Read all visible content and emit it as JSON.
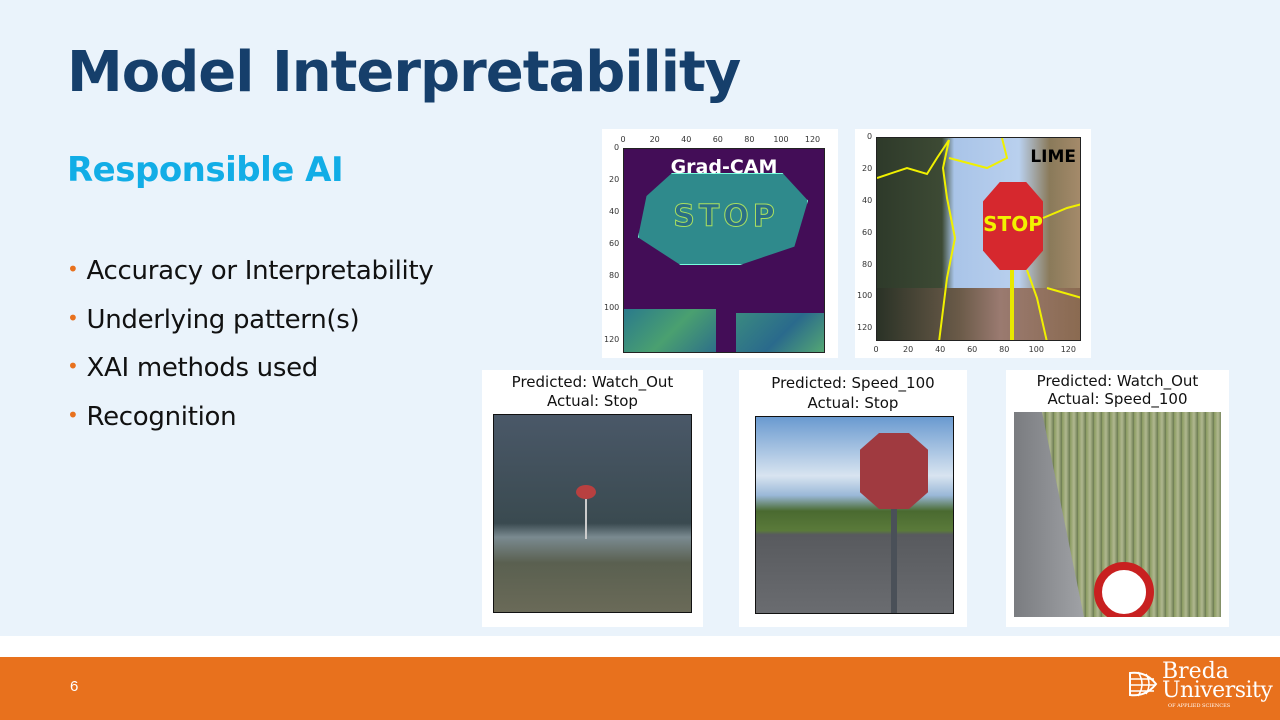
{
  "slide": {
    "title": "Model Interpretability",
    "subtitle": "Responsible AI",
    "bullets": [
      "Accuracy or Interpretability",
      "Underlying pattern(s)",
      "XAI methods used",
      "Recognition"
    ],
    "page_number": "6"
  },
  "figures": {
    "gradcam": {
      "label": "Grad-CAM",
      "ticks": [
        "0",
        "20",
        "40",
        "60",
        "80",
        "100",
        "120"
      ],
      "sign_text": "STOP"
    },
    "lime": {
      "label": "LIME",
      "ticks": [
        "0",
        "20",
        "40",
        "60",
        "80",
        "100",
        "120"
      ],
      "sign_text": "STOP"
    },
    "predictions": [
      {
        "predicted": "Predicted: Watch_Out",
        "actual": "Actual: Stop"
      },
      {
        "predicted": "Predicted: Speed_100",
        "actual": "Actual: Stop"
      },
      {
        "predicted": "Predicted: Watch_Out",
        "actual": "Actual: Speed_100"
      }
    ]
  },
  "logo": {
    "name": "Breda",
    "name2": "University",
    "tagline": "OF APPLIED SCIENCES"
  },
  "colors": {
    "title": "#163f6b",
    "subtitle": "#12ade6",
    "accent": "#e8711d",
    "background": "#eaf3fb"
  }
}
